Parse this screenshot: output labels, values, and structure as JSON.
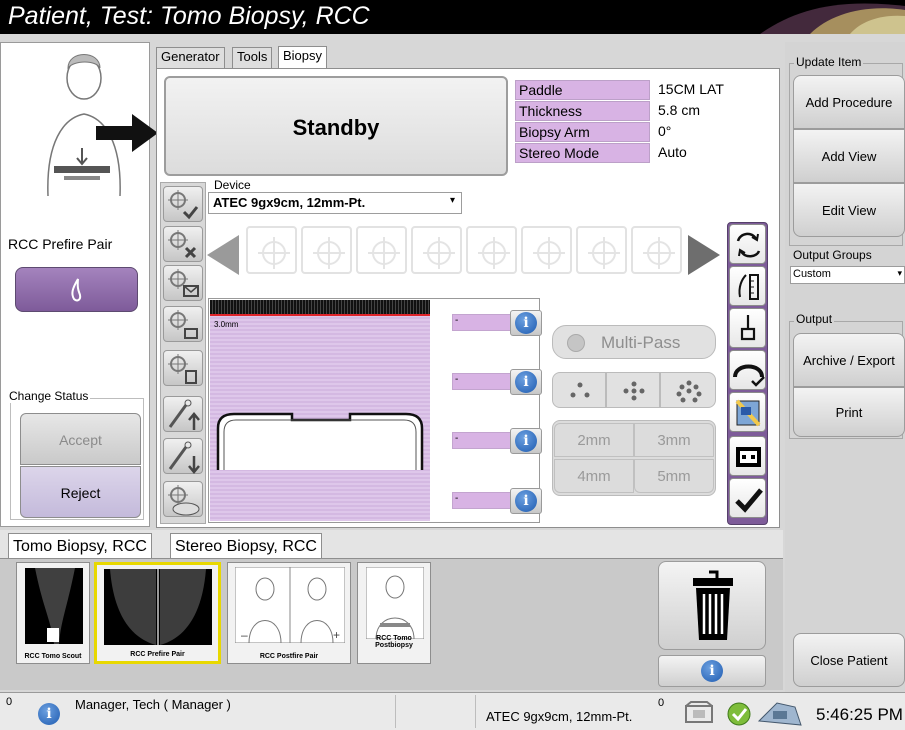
{
  "title": "Patient, Test: Tomo Biopsy, RCC",
  "left_panel": {
    "view_label": "RCC Prefire Pair",
    "change_status_label": "Change Status",
    "accept_label": "Accept",
    "reject_label": "Reject"
  },
  "tabs": [
    "Generator",
    "Tools",
    "Biopsy"
  ],
  "status_display": "Standby",
  "info_table": [
    {
      "label": "Paddle",
      "value": "15CM LAT"
    },
    {
      "label": "Thickness",
      "value": "5.8 cm"
    },
    {
      "label": "Biopsy Arm",
      "value": "0°"
    },
    {
      "label": "Stereo Mode",
      "value": "Auto"
    }
  ],
  "device": {
    "label": "Device",
    "selected": "ATEC 9gx9cm, 12mm-Pt."
  },
  "image_view": {
    "scale_label": "3.0mm"
  },
  "target_fields": [
    "-",
    "-",
    "-",
    "-"
  ],
  "multipass_label": "Multi-Pass",
  "mm_options": [
    "2mm",
    "3mm",
    "4mm",
    "5mm"
  ],
  "right_panel": {
    "update_item_label": "Update Item",
    "add_procedure": "Add Procedure",
    "add_view": "Add View",
    "edit_view": "Edit View",
    "output_groups_label": "Output Groups",
    "output_groups_value": "Custom",
    "output_label": "Output",
    "archive_export": "Archive / Export",
    "print": "Print",
    "close_patient": "Close Patient"
  },
  "procedure_tabs": [
    "Tomo Biopsy, RCC",
    "Stereo Biopsy, RCC"
  ],
  "thumbnails": [
    "RCC Tomo Scout",
    "RCC Prefire Pair",
    "RCC Postfire Pair",
    "RCC Tomo Postbiopsy"
  ],
  "statusbar": {
    "alarm_count": "0",
    "user": "Manager, Tech ( Manager )",
    "device": "ATEC 9gx9cm, 12mm-Pt.",
    "queue_count": "0",
    "time": "5:46:25 PM"
  },
  "colors": {
    "accent_purple": "#8e6aa8",
    "label_pink": "#d8b3e4",
    "title_bg": "#000000"
  }
}
